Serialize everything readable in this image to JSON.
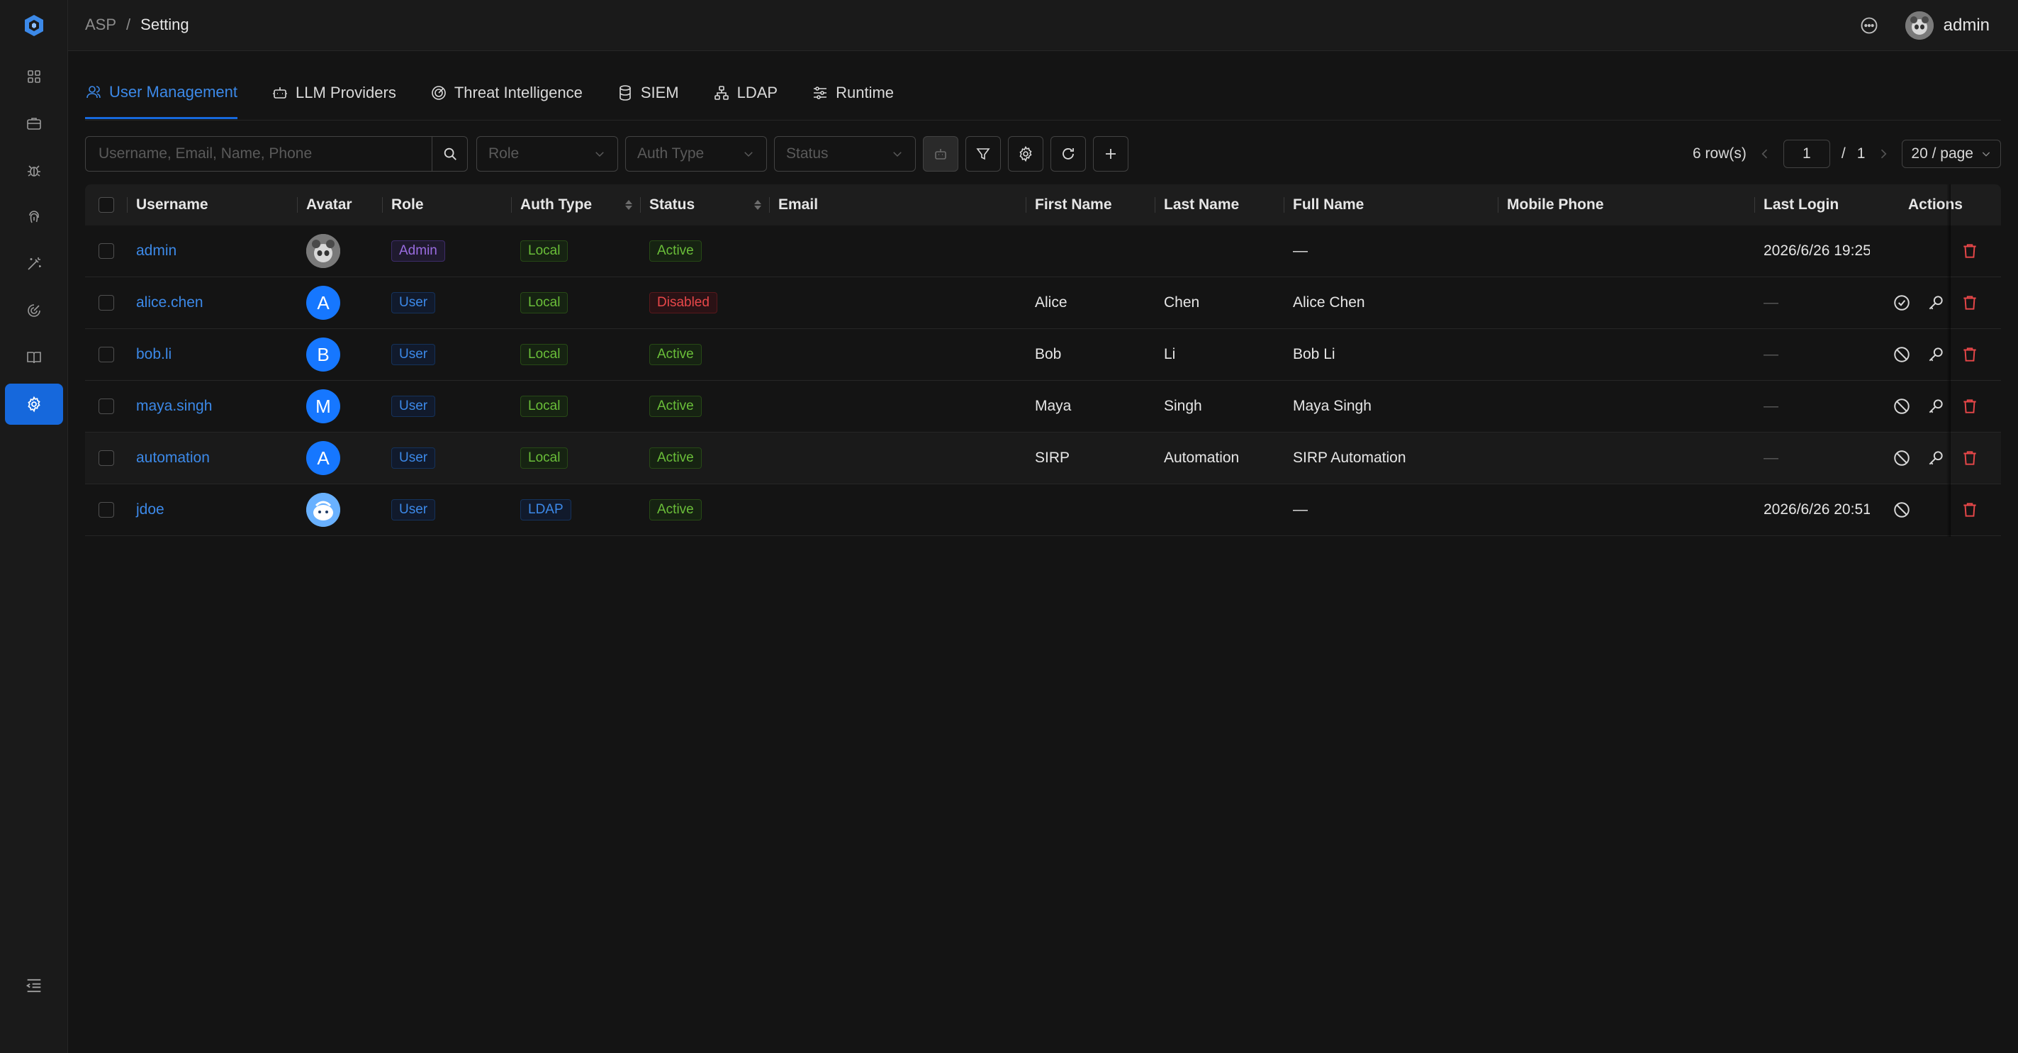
{
  "header": {
    "breadcrumb": [
      "ASP",
      "/",
      "Setting"
    ],
    "user_name": "admin"
  },
  "tabs": [
    {
      "label": "User Management",
      "icon": "user-icon",
      "active": true
    },
    {
      "label": "LLM Providers",
      "icon": "robot-icon",
      "active": false
    },
    {
      "label": "Threat Intelligence",
      "icon": "radar-icon",
      "active": false
    },
    {
      "label": "SIEM",
      "icon": "database-icon",
      "active": false
    },
    {
      "label": "LDAP",
      "icon": "cluster-icon",
      "active": false
    },
    {
      "label": "Runtime",
      "icon": "sliders-icon",
      "active": false
    }
  ],
  "toolbar": {
    "search_placeholder": "Username, Email, Name, Phone",
    "role_placeholder": "Role",
    "auth_placeholder": "Auth Type",
    "status_placeholder": "Status"
  },
  "pager": {
    "rows": "6 row(s)",
    "current": "1",
    "sep": "/",
    "total": "1",
    "size": "20 / page"
  },
  "columns": {
    "username": "Username",
    "avatar": "Avatar",
    "role": "Role",
    "auth_type": "Auth Type",
    "status": "Status",
    "email": "Email",
    "first_name": "First Name",
    "last_name": "Last Name",
    "full_name": "Full Name",
    "mobile": "Mobile Phone",
    "last_login": "Last Login",
    "actions": "Actions"
  },
  "rows": [
    {
      "username": "admin",
      "avatar": "",
      "role": "Admin",
      "auth": "Local",
      "status": "Active",
      "email": "",
      "first": "",
      "last": "",
      "full": "—",
      "mobile": "",
      "login": "2026/6/26 19:25"
    },
    {
      "username": "alice.chen",
      "avatar": "A",
      "role": "User",
      "auth": "Local",
      "status": "Disabled",
      "email": "",
      "first": "Alice",
      "last": "Chen",
      "full": "Alice Chen",
      "mobile": "",
      "login": "—"
    },
    {
      "username": "bob.li",
      "avatar": "B",
      "role": "User",
      "auth": "Local",
      "status": "Active",
      "email": "",
      "first": "Bob",
      "last": "Li",
      "full": "Bob Li",
      "mobile": "",
      "login": "—"
    },
    {
      "username": "maya.singh",
      "avatar": "M",
      "role": "User",
      "auth": "Local",
      "status": "Active",
      "email": "",
      "first": "Maya",
      "last": "Singh",
      "full": "Maya Singh",
      "mobile": "",
      "login": "—"
    },
    {
      "username": "automation",
      "avatar": "A",
      "role": "User",
      "auth": "Local",
      "status": "Active",
      "email": "",
      "first": "SIRP",
      "last": "Automation",
      "full": "SIRP Automation",
      "mobile": "",
      "login": "—"
    },
    {
      "username": "jdoe",
      "avatar": "",
      "role": "User",
      "auth": "LDAP",
      "status": "Active",
      "email": "",
      "first": "",
      "last": "",
      "full": "—",
      "mobile": "",
      "login": "2026/6/26 20:51"
    }
  ],
  "colors": {
    "accent": "#1668dc",
    "link": "#3c89e8",
    "danger": "#e84749",
    "success": "#6abe39"
  }
}
